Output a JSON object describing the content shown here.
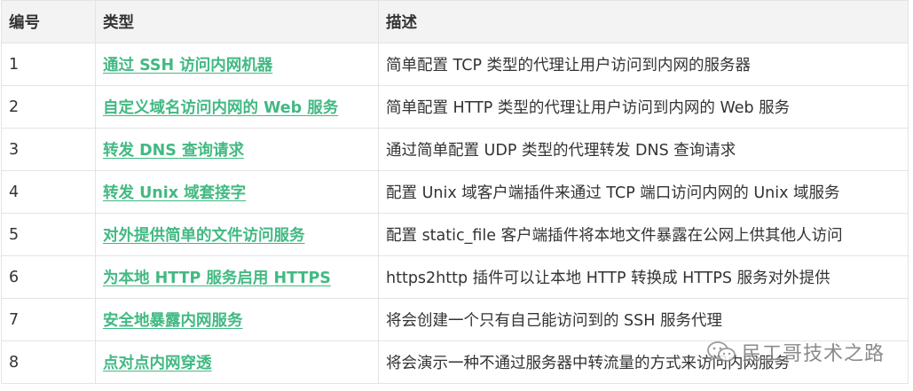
{
  "table": {
    "headers": [
      "编号",
      "类型",
      "描述"
    ],
    "rows": [
      {
        "num": "1",
        "type": "通过 SSH 访问内网机器",
        "desc": "简单配置 TCP 类型的代理让用户访问到内网的服务器"
      },
      {
        "num": "2",
        "type": "自定义域名访问内网的 Web 服务",
        "desc": "简单配置 HTTP 类型的代理让用户访问到内网的 Web 服务"
      },
      {
        "num": "3",
        "type": "转发 DNS 查询请求",
        "desc": "通过简单配置 UDP 类型的代理转发 DNS 查询请求"
      },
      {
        "num": "4",
        "type": "转发 Unix 域套接字",
        "desc": "配置 Unix 域客户端插件来通过 TCP 端口访问内网的 Unix 域服务"
      },
      {
        "num": "5",
        "type": "对外提供简单的文件访问服务",
        "desc": "配置 static_file 客户端插件将本地文件暴露在公网上供其他人访问"
      },
      {
        "num": "6",
        "type": "为本地 HTTP 服务启用 HTTPS",
        "desc": "https2http 插件可以让本地 HTTP 转换成 HTTPS 服务对外提供"
      },
      {
        "num": "7",
        "type": "安全地暴露内网服务",
        "desc": "将会创建一个只有自己能访问到的 SSH 服务代理"
      },
      {
        "num": "8",
        "type": "点对点内网穿透",
        "desc": "将会演示一种不通过服务器中转流量的方式来访问内网服务"
      }
    ]
  },
  "watermark": {
    "text": "民工哥技术之路",
    "icon": "wechat-icon"
  },
  "colors": {
    "link": "#42b983",
    "header_bg": "#f3f3f3",
    "border": "#e4e4e4",
    "text": "#333333"
  }
}
